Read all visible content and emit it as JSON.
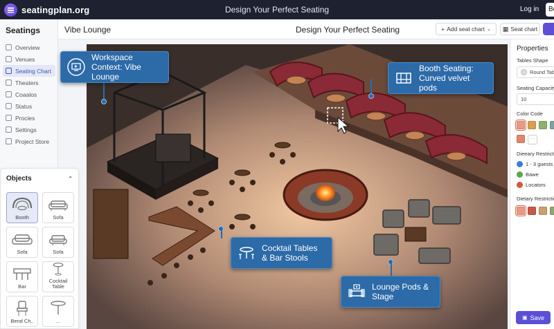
{
  "topbar": {
    "brand": "seatingplan.org",
    "title": "Design Your Perfect Seating",
    "login": "Log in",
    "signup_short": "Be"
  },
  "sidebar": {
    "title": "Seatings",
    "items": [
      {
        "label": "Overview",
        "icon": "overview-icon"
      },
      {
        "label": "Venues",
        "icon": "venues-icon"
      },
      {
        "label": "Seating Chart",
        "icon": "seating-chart-icon",
        "active": true
      },
      {
        "label": "Theaters",
        "icon": "theaters-icon"
      },
      {
        "label": "Coaalos",
        "icon": "coaalos-icon"
      },
      {
        "label": "Status",
        "icon": "status-icon"
      },
      {
        "label": "Procies",
        "icon": "procies-icon"
      },
      {
        "label": "Settings",
        "icon": "settings-icon"
      },
      {
        "label": "Project Store",
        "icon": "project-store-icon"
      }
    ]
  },
  "objects": {
    "title": "Objects",
    "items": [
      {
        "label": "Booth",
        "selected": true
      },
      {
        "label": "Sofa"
      },
      {
        "label": "Sofa"
      },
      {
        "label": "Sofa"
      },
      {
        "label": "Bar"
      },
      {
        "label": "Cocktail Table"
      },
      {
        "label": "Bend Ch.."
      },
      {
        "label": "..."
      }
    ]
  },
  "header": {
    "venue": "Vibe Lounge",
    "title": "Design Your Perfect Seating",
    "add_seat_chart": "Add seat chart",
    "seat_chart": "Seat chart"
  },
  "callouts": {
    "workspace": "Workspace Context: Vibe Lounge",
    "booth": "Booth Seating: Curved velvet pods",
    "cocktail": "Cocktail Tables & Bar Stools",
    "lounge": "Lounge Pods & Stage"
  },
  "properties": {
    "title": "Properties",
    "tables_shape_label": "Tables Shape",
    "tables_shape_value": "Round Table",
    "capacity_label": "Seating Capacity",
    "capacity_value": "10",
    "color_code_label": "Color Code",
    "color_swatches": [
      "#e79a86",
      "#d8a050",
      "#8fb06a",
      "#7aa59a",
      "#e0876a"
    ],
    "dieeary_label": "Dieeary Restrictions",
    "dieeary_options": [
      {
        "label": "1 - 3 guests",
        "color": "#3b7dd8"
      },
      {
        "label": "Bawe",
        "color": "#5aa84a"
      },
      {
        "label": "Locators",
        "color": "#d8553a"
      }
    ],
    "dietary_label": "Dietary Restrictions",
    "dietary_swatches": [
      "#e79a86",
      "#c9584a",
      "#c9a070",
      "#8fa868"
    ],
    "save": "Save"
  }
}
